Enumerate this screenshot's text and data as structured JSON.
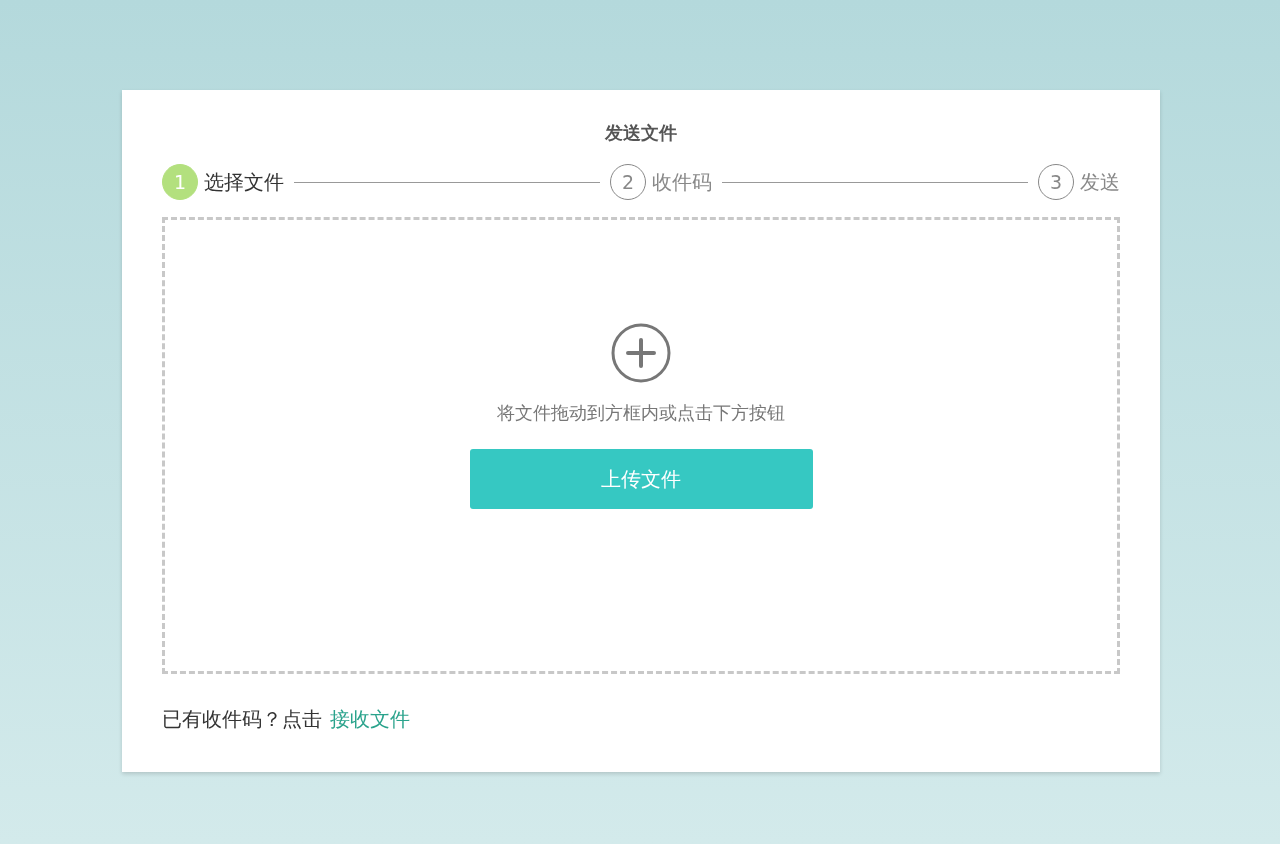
{
  "title": "发送文件",
  "steps": [
    {
      "number": "1",
      "label": "选择文件",
      "selected": true
    },
    {
      "number": "2",
      "label": "收件码",
      "selected": false
    },
    {
      "number": "3",
      "label": "发送",
      "selected": false
    }
  ],
  "dropzone": {
    "hint": "将文件拖动到方框内或点击下方按钮",
    "button": "上传文件"
  },
  "footer": {
    "text": "已有收件码？点击",
    "link": "接收文件"
  }
}
